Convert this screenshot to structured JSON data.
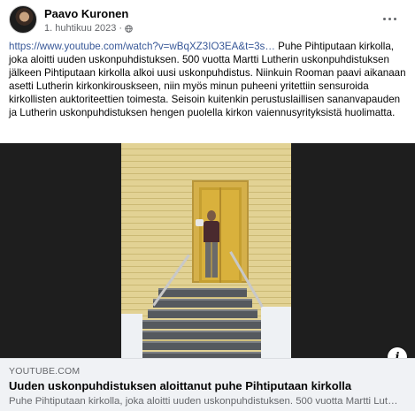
{
  "post": {
    "author": "Paavo Kuronen",
    "date": "1. huhtikuu 2023",
    "separator": "·",
    "privacy_icon": "globe-icon",
    "more_icon": "more-options-icon",
    "link_url": "https://www.youtube.com/watch?v=wBqXZ3IO3EA&t=3s…",
    "body_text": "Puhe Pihtiputaan kirkolla, joka aloitti uuden uskonpuhdistuksen. 500 vuotta Martti Lutherin uskonpuhdistuksen jälkeen Pihtiputaan kirkolla alkoi uusi uskonpuhdistus. Niinkuin Rooman paavi aikanaan asetti Lutherin kirkonkirouskseen, niin myös minun puheeni yritettiin sensuroida kirkollisten auktoriteettien toimesta. Seisoin kuitenkin perustuslaillisen sananvapauden ja Lutherin uskonpuhdistuksen hengen puolella kirkon vaiennusyrityksistä huolimatta."
  },
  "link_preview": {
    "domain": "YOUTUBE.COM",
    "title": "Uuden uskonpuhdistuksen aloittanut puhe Pihtiputaan kirkolla",
    "description": "Puhe Pihtiputaan kirkolla, joka aloitti uuden uskonpuhdistuksen. 500 vuotta Martti Lutherin uskonpuhdistuksen jälkeen Pihtiputaan kirkolla alkoi uusi uskonpuhdistus.",
    "info_label": "i"
  },
  "colors": {
    "link": "#385898",
    "muted": "#65676b",
    "preview_bg": "#f0f2f5"
  }
}
